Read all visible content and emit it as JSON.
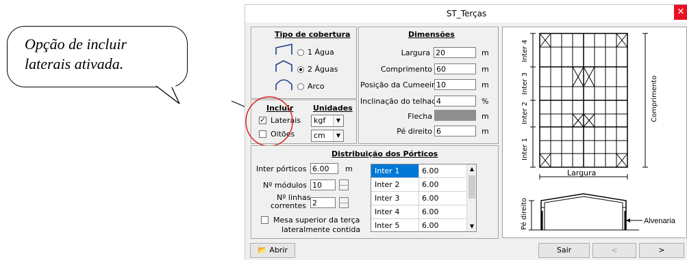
{
  "callout": {
    "line1": "Opção de incluir",
    "line2": "laterais ativada."
  },
  "window": {
    "title": "ST_Terças",
    "close_icon": "close-icon"
  },
  "tipo_cobertura": {
    "header": "Tipo de cobertura",
    "options": [
      {
        "label": "1 Água",
        "selected": false,
        "icon": "single-slope-roof-icon"
      },
      {
        "label": "2 Águas",
        "selected": true,
        "icon": "double-slope-roof-icon"
      },
      {
        "label": "Arco",
        "selected": false,
        "icon": "arch-roof-icon"
      }
    ]
  },
  "dimensoes": {
    "header": "Dimensões",
    "fields": [
      {
        "label": "Largura",
        "value": "20",
        "unit": "m"
      },
      {
        "label": "Comprimento",
        "value": "60",
        "unit": "m"
      },
      {
        "label": "Posição da Cumeeira",
        "value": "10",
        "unit": "m"
      },
      {
        "label": "Inclinação do telhado",
        "value": "4",
        "unit": "%"
      },
      {
        "label": "Flecha",
        "value": "",
        "unit": "m",
        "disabled": true
      },
      {
        "label": "Pé direito",
        "value": "6",
        "unit": "m"
      }
    ]
  },
  "incluir": {
    "header": "Incluir",
    "laterais": {
      "label": "Laterais",
      "checked": true
    },
    "oitoes": {
      "label": "Oitões",
      "checked": false
    }
  },
  "unidades": {
    "header": "Unidades",
    "force": "kgf",
    "length": "cm"
  },
  "distribuicao": {
    "header": "Distribuição dos Pórticos",
    "inter_porticos_label": "Inter pórticos",
    "inter_porticos_value": "6.00",
    "inter_porticos_unit": "m",
    "modulos_label": "Nº módulos",
    "modulos_value": "10",
    "linhas_label_1": "Nº linhas",
    "linhas_label_2": "correntes",
    "linhas_value": "2",
    "mesa_label_1": "Mesa superior da terça",
    "mesa_label_2": "lateralmente contida",
    "mesa_checked": false,
    "grid": [
      {
        "name": "Inter 1",
        "value": "6.00"
      },
      {
        "name": "Inter 2",
        "value": "6.00"
      },
      {
        "name": "Inter 3",
        "value": "6.00"
      },
      {
        "name": "Inter 4",
        "value": "6.00"
      },
      {
        "name": "Inter 5",
        "value": "6.00"
      }
    ]
  },
  "drawing": {
    "inter_labels": [
      "Inter 4",
      "Inter 3",
      "Inter 2",
      "Inter 1"
    ],
    "comprimento": "Comprimento",
    "largura": "Largura",
    "pe_direito": "Pé direito",
    "alvenaria": "Alvenaria"
  },
  "footer": {
    "abrir": "Abrir",
    "sair": "Sair",
    "prev": "<",
    "next": ">"
  },
  "colors": {
    "highlight_circle": "#d9231f",
    "selection": "#0078d7",
    "close": "#e81123"
  }
}
